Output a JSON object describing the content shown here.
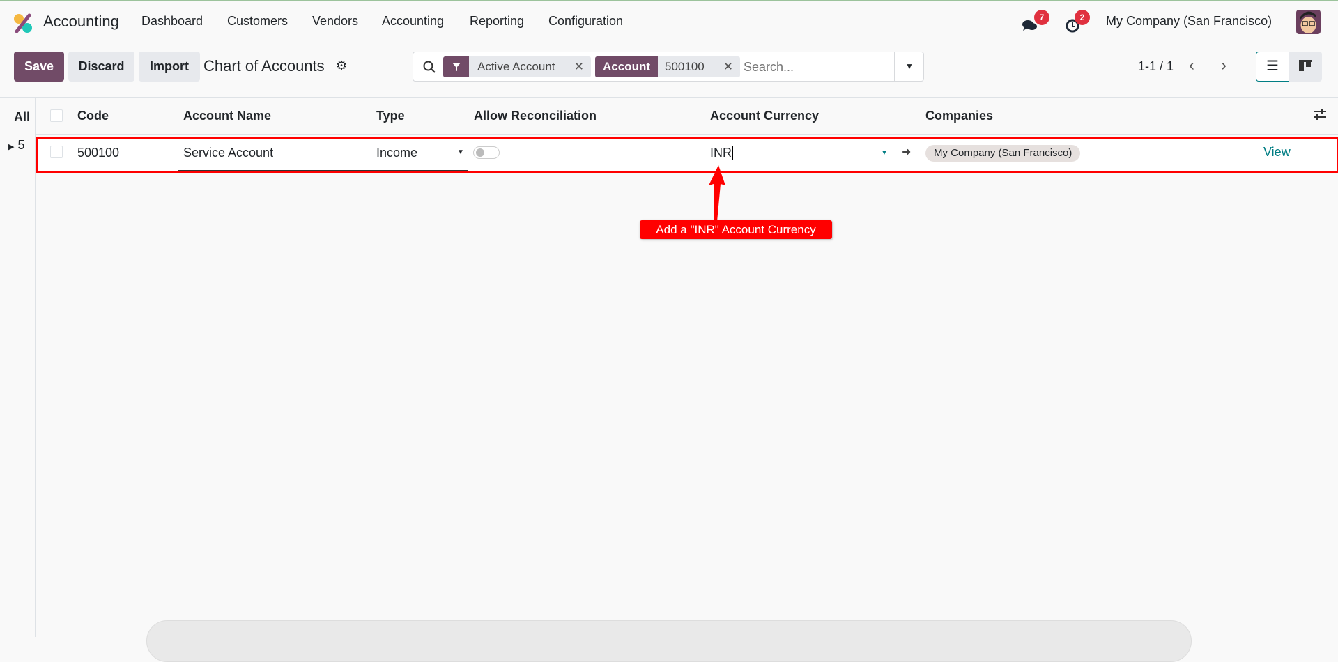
{
  "navbar": {
    "app": "Accounting",
    "menu": [
      "Dashboard",
      "Customers",
      "Vendors",
      "Accounting",
      "Reporting",
      "Configuration"
    ],
    "messages_badge": "7",
    "activities_badge": "2",
    "company": "My Company (San Francisco)"
  },
  "control": {
    "save": "Save",
    "discard": "Discard",
    "import": "Import",
    "title": "Chart of Accounts",
    "facets": [
      {
        "label": "Active Account"
      },
      {
        "field": "Account",
        "value": "500100"
      }
    ],
    "search_placeholder": "Search...",
    "pager": "1-1 / 1"
  },
  "sidebar": {
    "all": "All",
    "group_count": "5"
  },
  "table": {
    "headers": [
      "Code",
      "Account Name",
      "Type",
      "Allow Reconciliation",
      "Account Currency",
      "Companies"
    ],
    "row": {
      "code": "500100",
      "name": "Service Account",
      "type": "Income",
      "reconcile": false,
      "currency": "INR",
      "company": "My Company (San Francisco)",
      "view": "View"
    }
  },
  "annotation": {
    "text": "Add a \"INR\" Account Currency",
    "color": "#ff0000"
  },
  "colors": {
    "primary": "#714b67",
    "link": "#017e84"
  }
}
